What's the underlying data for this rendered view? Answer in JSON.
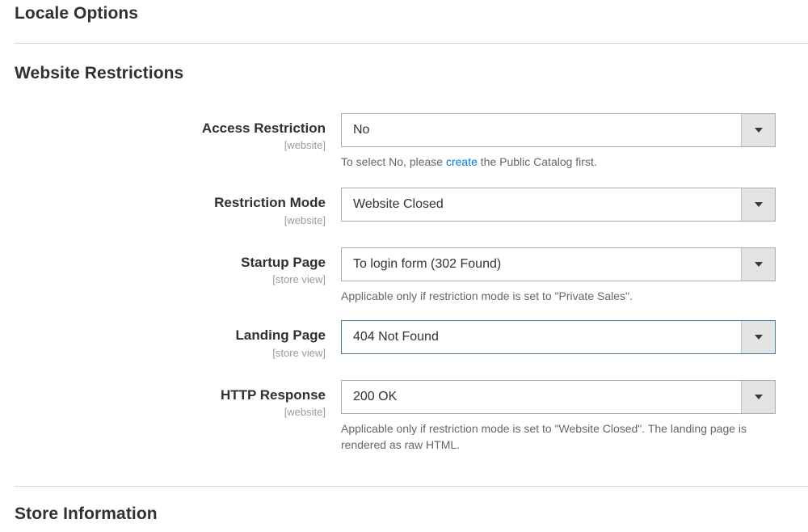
{
  "sections": {
    "locale_options_title": "Locale Options",
    "website_restrictions_title": "Website Restrictions",
    "store_information_title": "Store Information"
  },
  "form": {
    "rows": [
      {
        "label": "Access Restriction",
        "scope": "[website]",
        "value": "No",
        "hint_before_link": "To select No, please ",
        "hint_link": "create",
        "hint_after_link": " the Public Catalog first."
      },
      {
        "label": "Restriction Mode",
        "scope": "[website]",
        "value": "Website Closed",
        "hint": ""
      },
      {
        "label": "Startup Page",
        "scope": "[store view]",
        "value": "To login form (302 Found)",
        "hint": "Applicable only if restriction mode is set to \"Private Sales\"."
      },
      {
        "label": "Landing Page",
        "scope": "[store view]",
        "value": "404 Not Found",
        "hint": "",
        "focused": true
      },
      {
        "label": "HTTP Response",
        "scope": "[website]",
        "value": "200 OK",
        "hint": "Applicable only if restriction mode is set to \"Website Closed\". The landing page is rendered as raw HTML."
      }
    ]
  },
  "colors": {
    "heading": "#303030",
    "label": "#303030",
    "scope": "#9b9b9b",
    "value": "#333333",
    "hint": "#666666",
    "link": "#007bdb",
    "select_border": "#adadad",
    "select_focus_border": "#4e7a94",
    "arrow_button_bg": "#e3e3e3",
    "divider": "#d6d6d6",
    "page_bg": "#ffffff"
  },
  "icons": {
    "dropdown": "chevron-down-icon"
  }
}
